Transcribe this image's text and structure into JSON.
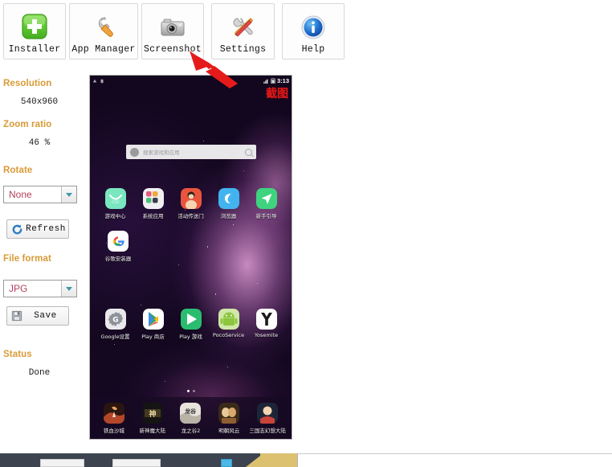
{
  "toolbar": {
    "buttons": [
      {
        "label": "Installer",
        "icon": "installer-plus-icon"
      },
      {
        "label": "App Manager",
        "icon": "wrench-icon"
      },
      {
        "label": "Screenshot",
        "icon": "camera-icon"
      },
      {
        "label": "Settings",
        "icon": "tools-cross-icon"
      },
      {
        "label": "Help",
        "icon": "info-circle-icon"
      }
    ]
  },
  "sidebar": {
    "resolution_title": "Resolution",
    "resolution_value": "540x960",
    "zoom_title": "Zoom ratio",
    "zoom_value": "46 %",
    "rotate_title": "Rotate",
    "rotate_value": "None",
    "refresh_label": "Refresh",
    "fileformat_title": "File format",
    "fileformat_value": "JPG",
    "save_label": "Save",
    "status_title": "Status",
    "status_value": "Done",
    "accent_color": "#d89a36",
    "combo_text_color": "#b4405c",
    "combo_arrow_color": "#3f9aa8"
  },
  "annotation": {
    "arrow_color": "#e51b1b",
    "overlay_text": "截图",
    "overlay_color": "#e01b1b"
  },
  "phone": {
    "statusbar": {
      "time": "3:13",
      "icons": [
        "signal-icon",
        "wifi-icon",
        "battery-icon"
      ]
    },
    "search": {
      "placeholder": "搜索游戏和应用",
      "icon": "app-store-icon",
      "magnifier": "search-icon"
    },
    "rows": [
      [
        {
          "label": "游戏中心",
          "icon": "game-center-icon"
        },
        {
          "label": "系统应用",
          "icon": "system-apps-folder-icon"
        },
        {
          "label": "活动传送门",
          "icon": "activity-portal-icon"
        },
        {
          "label": "浏览器",
          "icon": "browser-icon"
        },
        {
          "label": "新手引导",
          "icon": "guide-icon"
        }
      ],
      [
        {
          "label": "谷歌安装器",
          "icon": "google-installer-icon"
        }
      ],
      [
        {
          "label": "Google设置",
          "icon": "google-settings-icon"
        },
        {
          "label": "Play 商店",
          "icon": "play-store-icon"
        },
        {
          "label": "Play 游戏",
          "icon": "play-games-icon"
        },
        {
          "label": "PocoService",
          "icon": "android-icon"
        },
        {
          "label": "Yosemite",
          "icon": "yosemite-icon"
        }
      ]
    ],
    "page_dots": {
      "count": 2,
      "active": 0
    },
    "dock": [
      {
        "label": "铁血沙城",
        "icon": "game-tiexue-icon"
      },
      {
        "label": "新神魔大陆",
        "icon": "game-shenmo-icon"
      },
      {
        "label": "龙之谷2",
        "icon": "game-dragonnest-icon"
      },
      {
        "label": "明朝风云",
        "icon": "game-mingchao-icon"
      },
      {
        "label": "三国志幻想大陆",
        "icon": "game-sanguo-icon"
      }
    ]
  }
}
